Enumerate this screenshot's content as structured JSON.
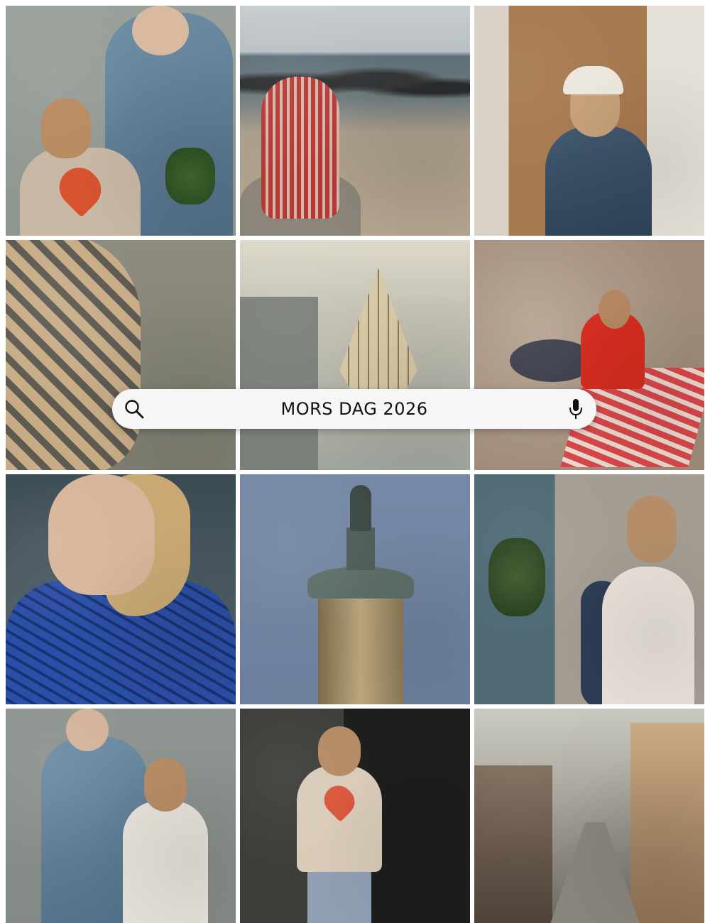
{
  "search": {
    "query": "MORS DAG 2026",
    "search_icon": "search-icon",
    "mic_icon": "microphone-icon"
  },
  "grid": {
    "tiles": [
      "figurehead-with-girl-in-heart-sweater",
      "beach-person-in-striped-blanket",
      "girl-in-cap-and-denim-jacket",
      "zebra-print-fabric-over-water",
      "ship-model-in-hallway",
      "girl-on-striped-beach-towel",
      "smiling-woman-in-blue-top",
      "column-with-statue",
      "girl-in-white-tee-beside-figurehead",
      "figurehead-with-girl-in-white-tee",
      "girl-in-heart-sweater-by-door",
      "city-street-view"
    ]
  },
  "colors": {
    "search_bg": "#f6f6f6",
    "search_text": "#111111",
    "accent_heart": "#d6532e"
  }
}
